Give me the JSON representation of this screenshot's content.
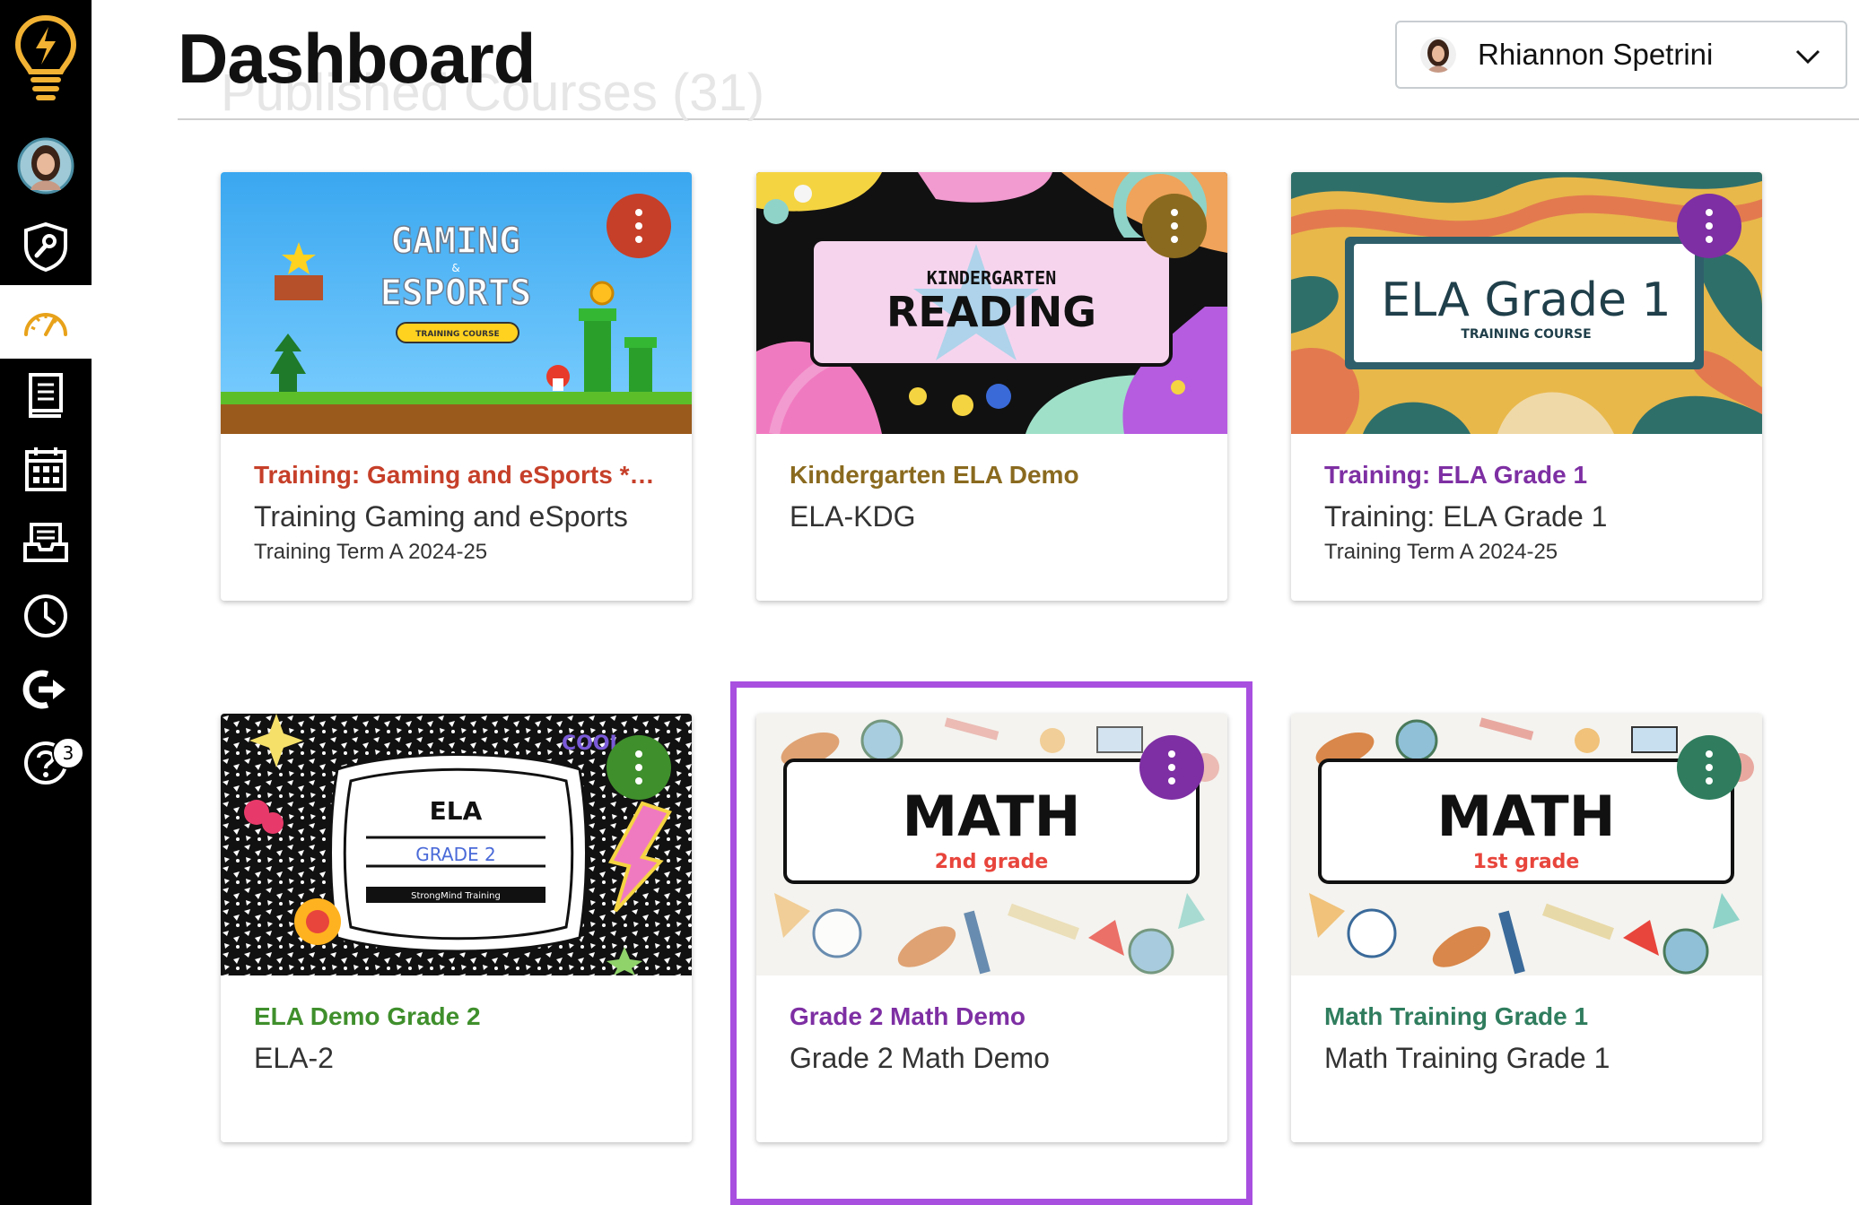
{
  "header": {
    "title": "Dashboard",
    "ghost_title": "Published Courses (31)",
    "user_name": "Rhiannon Spetrini"
  },
  "sidebar": {
    "items": [
      {
        "name": "logo",
        "icon": "lightbulb-icon"
      },
      {
        "name": "account",
        "icon": "avatar"
      },
      {
        "name": "admin",
        "icon": "shield-wrench-icon"
      },
      {
        "name": "dashboard",
        "icon": "speedometer-icon",
        "active": true
      },
      {
        "name": "courses",
        "icon": "book-icon"
      },
      {
        "name": "calendar",
        "icon": "calendar-icon"
      },
      {
        "name": "inbox",
        "icon": "inbox-icon"
      },
      {
        "name": "history",
        "icon": "clock-icon"
      },
      {
        "name": "commons",
        "icon": "share-arrow-icon"
      },
      {
        "name": "help",
        "icon": "help-icon",
        "badge": "3"
      }
    ]
  },
  "courses": [
    {
      "title": "Training: Gaming and eSports *NE...",
      "code": "Training Gaming and eSports",
      "term": "Training Term A 2024-25",
      "color": "#c63f29",
      "banner_main": "GAMING",
      "banner_amp": "&",
      "banner_sub": "ESPORTS",
      "banner_tag": "TRAINING COURSE"
    },
    {
      "title": "Kindergarten ELA Demo",
      "code": "ELA-KDG",
      "term": "",
      "color": "#8a6a1f",
      "banner_top": "KINDERGARTEN",
      "banner_main": "READING"
    },
    {
      "title": "Training: ELA Grade 1",
      "code": "Training: ELA Grade 1",
      "term": "Training Term A 2024-25",
      "color": "#7e2fa3",
      "banner_main": "ELA Grade 1",
      "banner_sub": "TRAINING COURSE"
    },
    {
      "title": "ELA Demo Grade 2",
      "code": "ELA-2",
      "term": "",
      "color": "#3f8f2c",
      "banner_main": "ELA",
      "banner_sub": "GRADE 2",
      "banner_tag": "StrongMind Training",
      "banner_cool": "COOL"
    },
    {
      "title": "Grade 2 Math Demo",
      "code": "Grade 2 Math Demo",
      "term": "",
      "color": "#7e2fa3",
      "banner_main": "MATH",
      "banner_sub": "2nd grade"
    },
    {
      "title": "Math Training Grade 1",
      "code": "Math Training Grade 1",
      "term": "",
      "color": "#2f7d5e",
      "banner_main": "MATH",
      "banner_sub": "1st grade"
    }
  ],
  "accent_colors": {
    "highlight": "#a84fe0",
    "math_sub": "#e8453c"
  }
}
